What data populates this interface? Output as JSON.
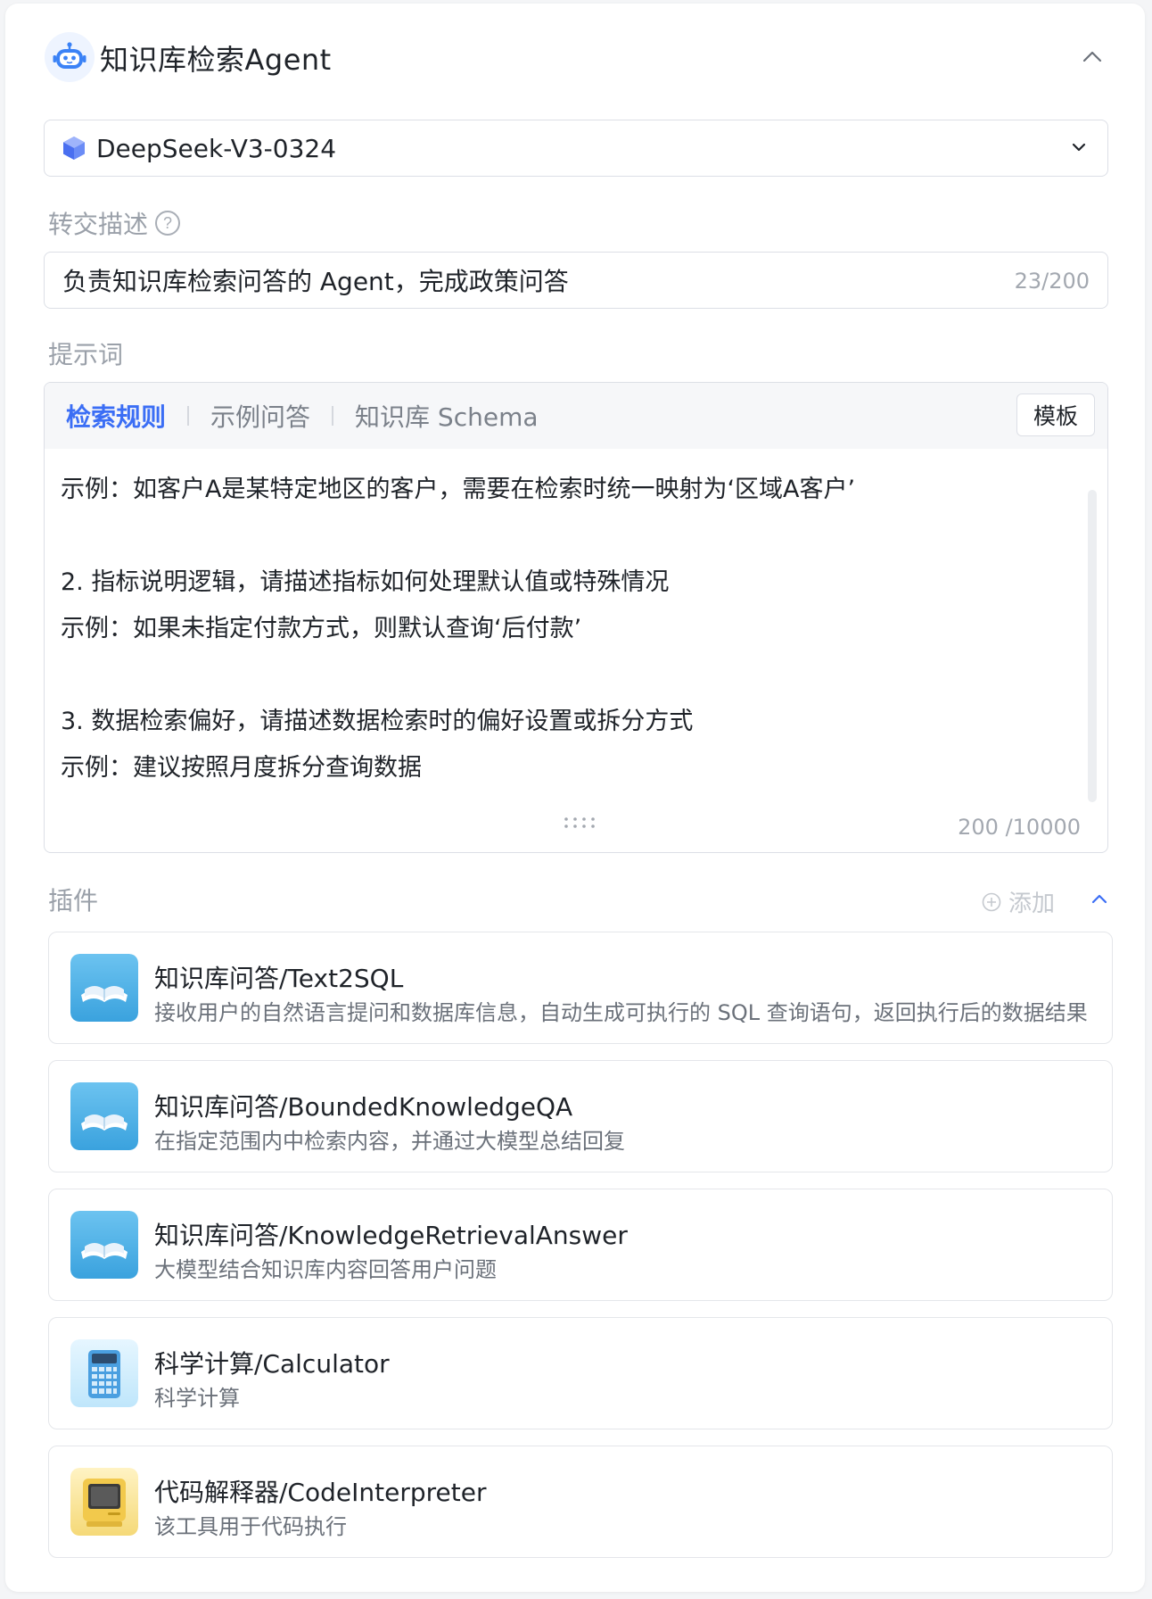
{
  "header": {
    "title": "知识库检索Agent",
    "icon": "robot-icon"
  },
  "model": {
    "name": "DeepSeek-V3-0324",
    "icon": "cube-icon"
  },
  "transfer": {
    "label": "转交描述",
    "value": "负责知识库检索问答的 Agent，完成政策问答",
    "count": "23/200"
  },
  "prompt": {
    "label": "提示词",
    "tabs": [
      {
        "label": "检索规则",
        "active": true
      },
      {
        "label": "示例问答",
        "active": false
      },
      {
        "label": "知识库 Schema",
        "active": false
      }
    ],
    "template_button": "模板",
    "lines": [
      "示例：如客户A是某特定地区的客户，需要在检索时统一映射为‘区域A客户’",
      "",
      "2. 指标说明逻辑，请描述指标如何处理默认值或特殊情况",
      "示例：如果未指定付款方式，则默认查询‘后付款’",
      "",
      "3. 数据检索偏好，请描述数据检索时的偏好设置或拆分方式",
      "示例：建议按照月度拆分查询数据"
    ],
    "count": "200 /10000"
  },
  "plugins": {
    "label": "插件",
    "add_label": "添加",
    "items": [
      {
        "name": "知识库问答/Text2SQL",
        "desc": "接收用户的自然语言提问和数据库信息，自动生成可执行的 SQL 查询语句，返回执行后的数据结果",
        "icon": "book-icon"
      },
      {
        "name": "知识库问答/BoundedKnowledgeQA",
        "desc": "在指定范围内中检索内容，并通过大模型总结回复",
        "icon": "book-icon"
      },
      {
        "name": "知识库问答/KnowledgeRetrievalAnswer",
        "desc": "大模型结合知识库内容回答用户问题",
        "icon": "book-icon"
      },
      {
        "name": "科学计算/Calculator",
        "desc": "科学计算",
        "icon": "calculator-icon"
      },
      {
        "name": "代码解释器/CodeInterpreter",
        "desc": "该工具用于代码执行",
        "icon": "computer-icon"
      }
    ]
  },
  "colors": {
    "accent": "#3b6ef5",
    "border": "#dcdfe6",
    "muted": "#9aa0a9"
  }
}
